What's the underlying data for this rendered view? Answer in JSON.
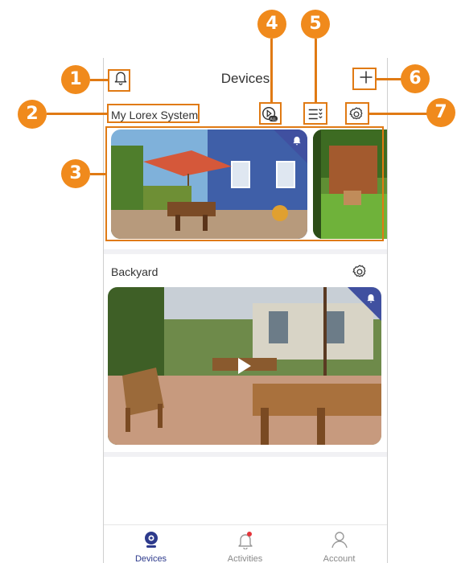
{
  "header": {
    "title": "Devices"
  },
  "system": {
    "name": "My Lorex System"
  },
  "group": {
    "name": "Backyard"
  },
  "tabs": [
    {
      "label": "Devices",
      "icon": "camera-icon",
      "active": true
    },
    {
      "label": "Activities",
      "icon": "bell-icon",
      "active": false
    },
    {
      "label": "Account",
      "icon": "user-icon",
      "active": false
    }
  ],
  "callouts": [
    "1",
    "2",
    "3",
    "4",
    "5",
    "6",
    "7"
  ],
  "colors": {
    "accent": "#2d3a8c",
    "callout": "#f08a1c",
    "alert_corner": "#4050a0"
  }
}
